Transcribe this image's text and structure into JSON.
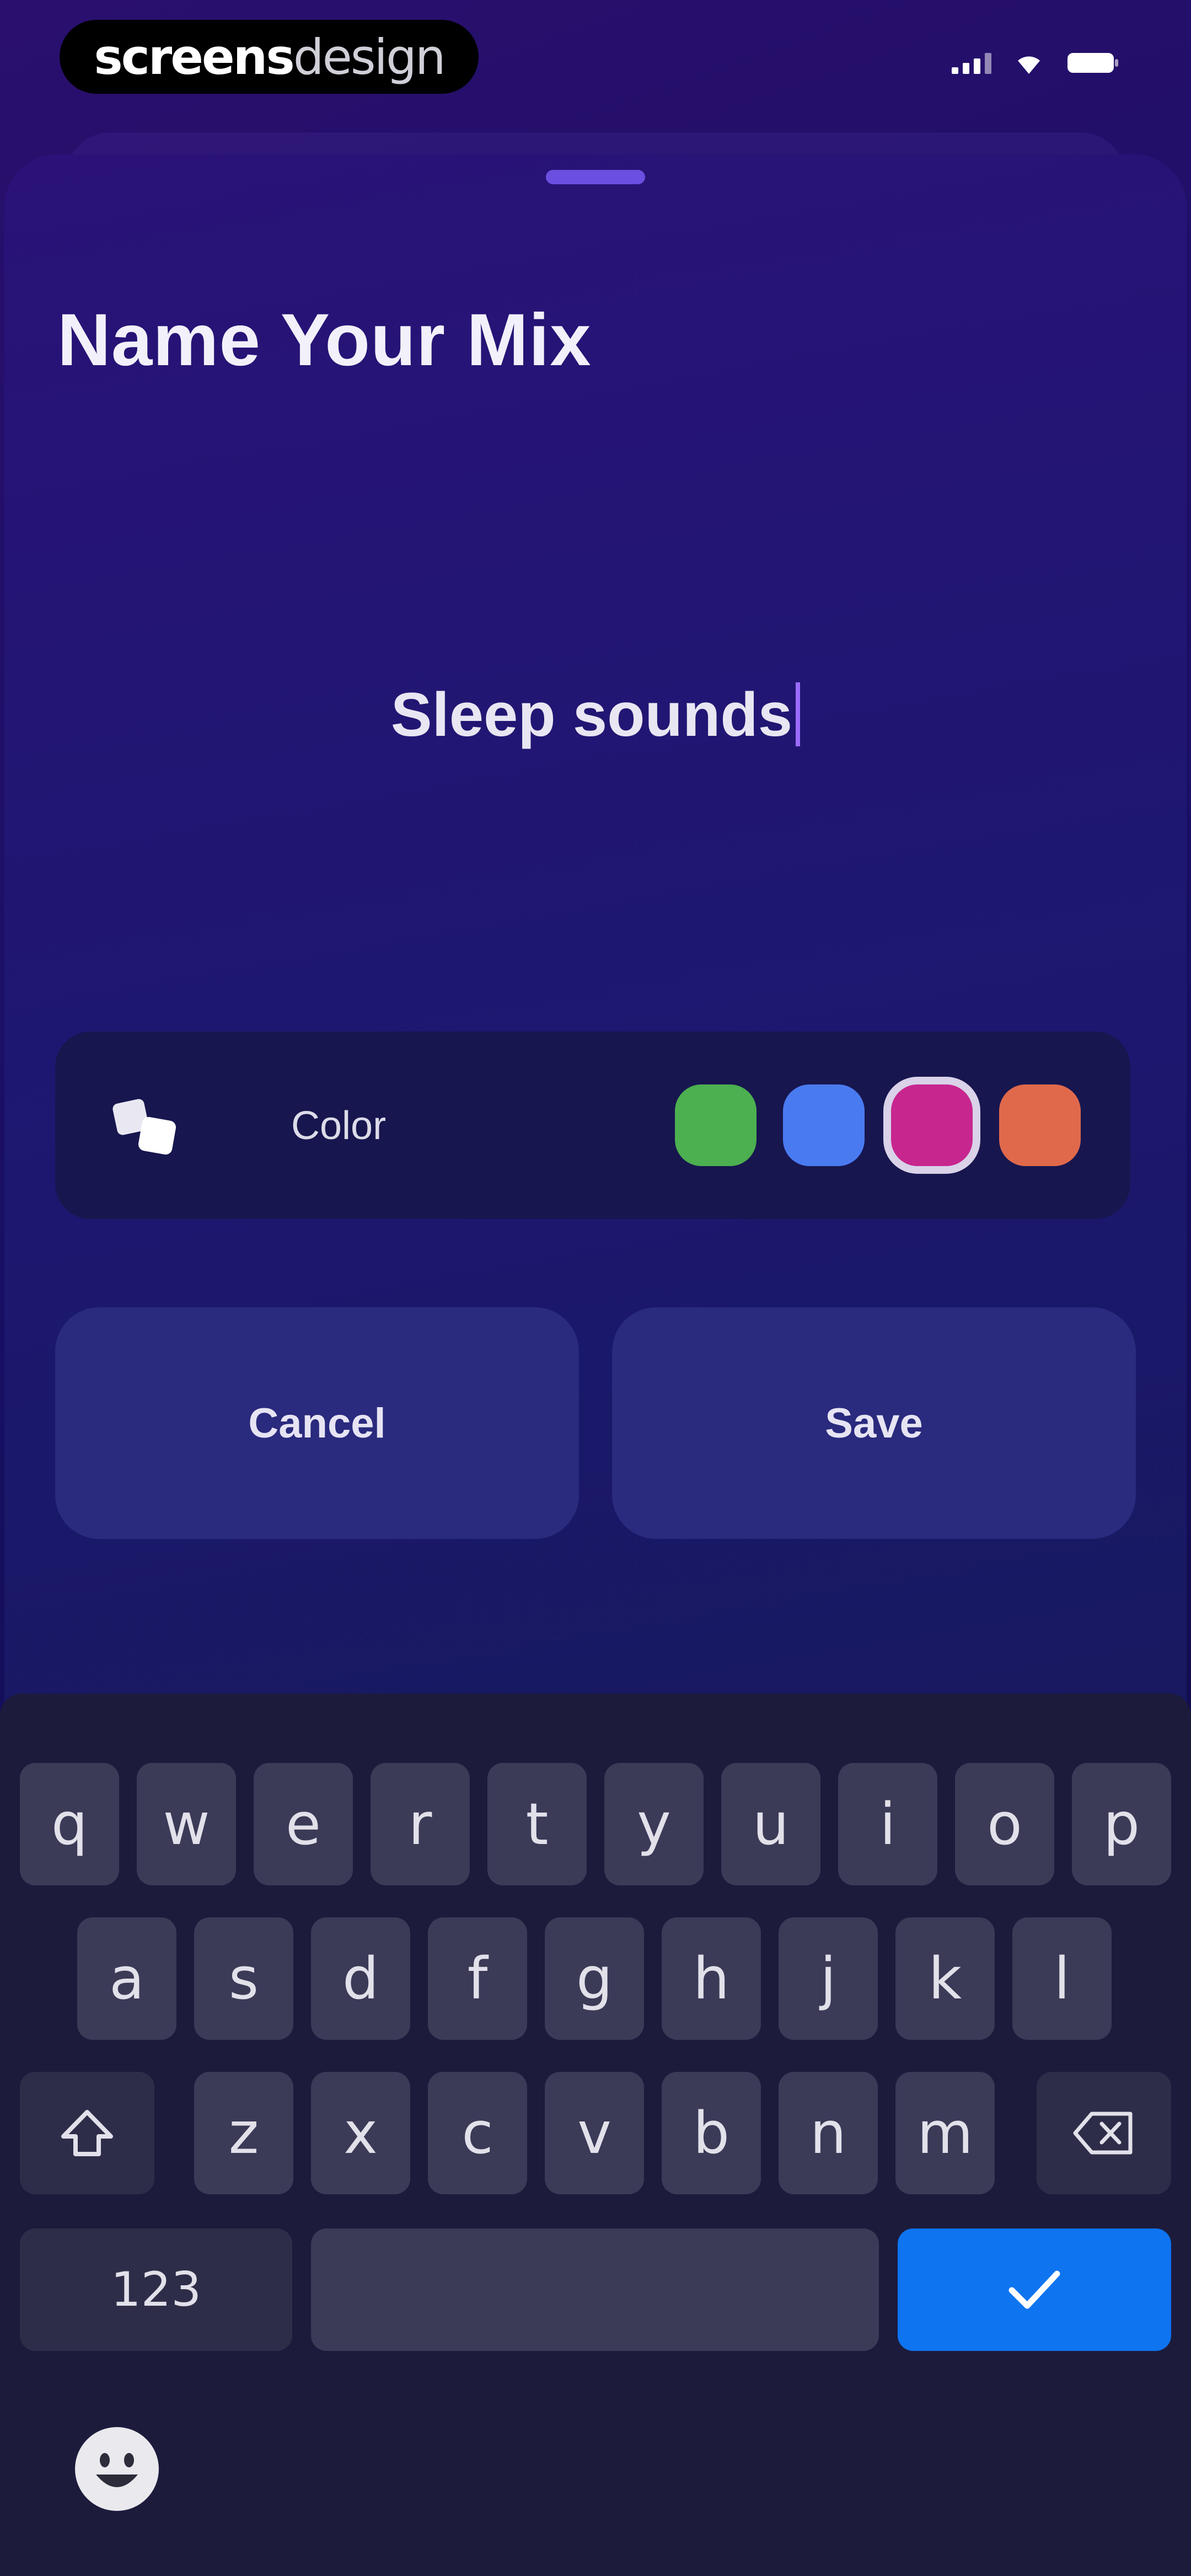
{
  "status_bar": {
    "brand_part1": "screens",
    "brand_part2": "design"
  },
  "sheet": {
    "title": "Name Your Mix",
    "name_input_value": "Sleep sounds",
    "color_row": {
      "label": "Color",
      "icon": "color-palette-icon",
      "swatches": [
        {
          "name": "green",
          "hex": "#4caf50",
          "selected": false
        },
        {
          "name": "blue",
          "hex": "#4a7af0",
          "selected": false
        },
        {
          "name": "magenta",
          "hex": "#c7268f",
          "selected": true
        },
        {
          "name": "orange",
          "hex": "#e0694c",
          "selected": false
        }
      ]
    },
    "cancel_label": "Cancel",
    "save_label": "Save"
  },
  "keyboard": {
    "row1": [
      "q",
      "w",
      "e",
      "r",
      "t",
      "y",
      "u",
      "i",
      "o",
      "p"
    ],
    "row2": [
      "a",
      "s",
      "d",
      "f",
      "g",
      "h",
      "j",
      "k",
      "l"
    ],
    "row3": [
      "z",
      "x",
      "c",
      "v",
      "b",
      "n",
      "m"
    ],
    "numbers_label": "123",
    "done_icon": "checkmark-icon",
    "shift_icon": "shift-icon",
    "delete_icon": "backspace-icon",
    "emoji_icon": "emoji-icon"
  },
  "colors": {
    "accent": "#6b4fe0",
    "done_key": "#0e74f0",
    "button_bg": "#2a2a7e"
  }
}
